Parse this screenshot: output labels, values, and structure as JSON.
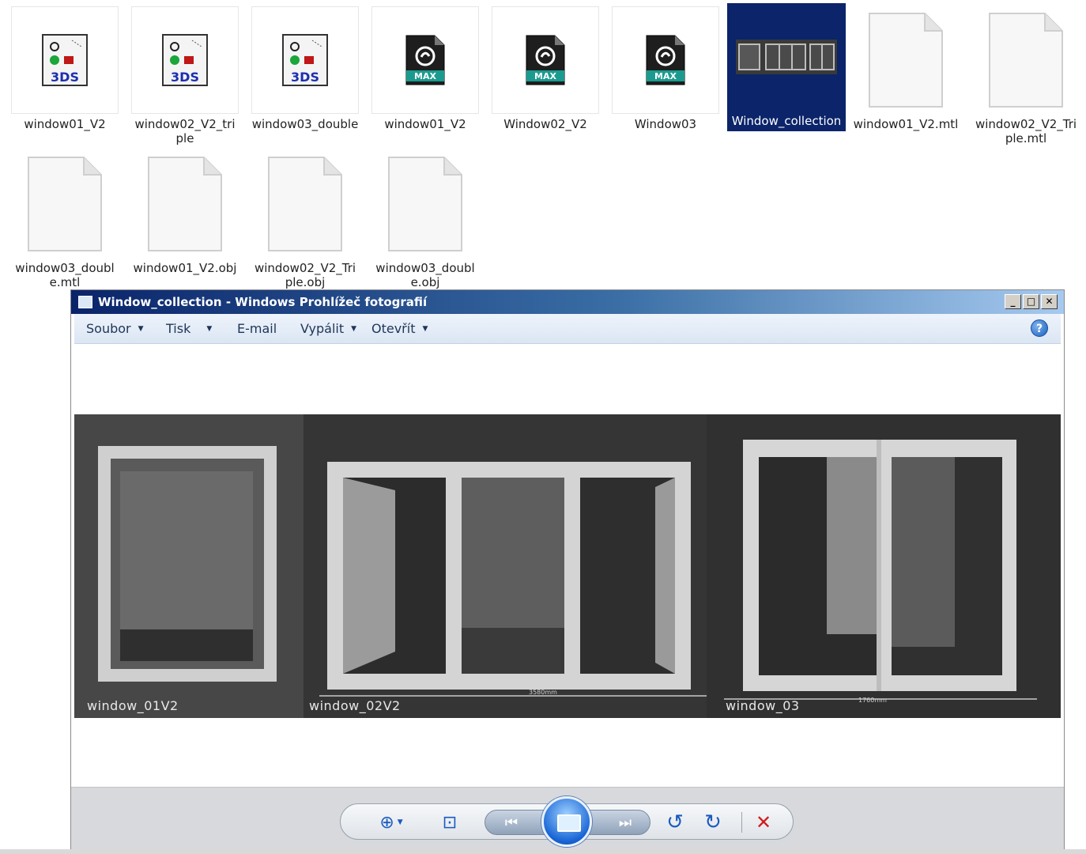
{
  "explorer": {
    "files": [
      {
        "name": "window01_V2",
        "type": "3DS"
      },
      {
        "name": "window02_V2_triple",
        "type": "3DS"
      },
      {
        "name": "window03_double",
        "type": "3DS"
      },
      {
        "name": "window01_V2",
        "type": "MAX"
      },
      {
        "name": "Window02_V2",
        "type": "MAX"
      },
      {
        "name": "Window03",
        "type": "MAX"
      },
      {
        "name": "Window_collection",
        "type": "image",
        "selected": true
      },
      {
        "name": "window01_V2.mtl",
        "type": "doc"
      },
      {
        "name": "window02_V2_Triple.mtl",
        "type": "doc"
      },
      {
        "name": "window03_double.mtl",
        "type": "doc"
      },
      {
        "name": "window01_V2.obj",
        "type": "doc"
      },
      {
        "name": "window02_V2_Triple.obj",
        "type": "doc"
      },
      {
        "name": "window03_double.obj",
        "type": "doc"
      }
    ],
    "icon_labels": {
      "three_ds": "3DS",
      "max": "MAX"
    },
    "selection_color": "#0b246a"
  },
  "viewer": {
    "title": "Window_collection - Windows Prohlížeč fotografií",
    "window_buttons": {
      "minimize": "_",
      "maximize": "□",
      "close": "✕"
    },
    "menu": [
      {
        "label": "Soubor",
        "has_dropdown": true
      },
      {
        "label": "Tisk",
        "has_dropdown": true
      },
      {
        "label": "E-mail",
        "has_dropdown": false
      },
      {
        "label": "Vypálit",
        "has_dropdown": true
      },
      {
        "label": "Otevřít",
        "has_dropdown": true
      }
    ],
    "help_label": "?",
    "photo": {
      "labels": [
        "window_01V2",
        "window_02V2",
        "window_03"
      ],
      "dimensions": [
        "3580mm",
        "1760mm"
      ]
    },
    "toolbar": {
      "zoom": "⊕",
      "fit": "⊡",
      "prev": "⏮",
      "next": "⏭",
      "rotate_ccw": "↺",
      "rotate_cw": "↻",
      "delete": "✕"
    }
  }
}
